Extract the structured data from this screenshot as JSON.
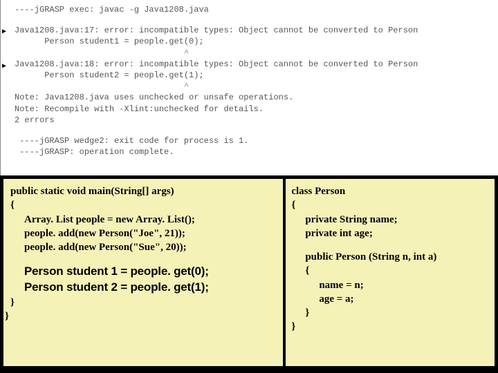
{
  "console": {
    "l1": "----jGRASP exec: javac -g Java1208.java",
    "err1a": "Java1208.java:17: error: incompatible types: Object cannot be converted to Person",
    "err1b": "      Person student1 = people.get(0);",
    "err1c": "                                  ^",
    "err2a": "Java1208.java:18: error: incompatible types: Object cannot be converted to Person",
    "err2b": "      Person student2 = people.get(1);",
    "err2c": "                                  ^",
    "note1": "Note: Java1208.java uses unchecked or unsafe operations.",
    "note2": "Note: Recompile with -Xlint:unchecked for details.",
    "count": "2 errors",
    "exit": " ----jGRASP wedge2: exit code for process is 1.",
    "done": " ----jGRASP: operation complete."
  },
  "left": {
    "sig": "public static void main(String[] args)",
    "brace_open": "{",
    "l1a": "Array. List people = new Array. List();",
    "l1b": "people. add(new Person(\"Joe\", 21));",
    "l1c": "people. add(new Person(\"Sue\", 20));",
    "hi1": "Person student 1 = people. get(0);",
    "hi2": "Person student 2 = people. get(1);",
    "brace_close1": "}",
    "brace_close2": "}"
  },
  "right": {
    "cls": "class Person",
    "brace_open": "{",
    "f1": "private String name;",
    "f2": "private int age;",
    "ctor": "public Person (String n, int a)",
    "brace_open2": "{",
    "b1": "name = n;",
    "b2": "age = a;",
    "brace_close1": "}",
    "brace_close2": "}"
  }
}
